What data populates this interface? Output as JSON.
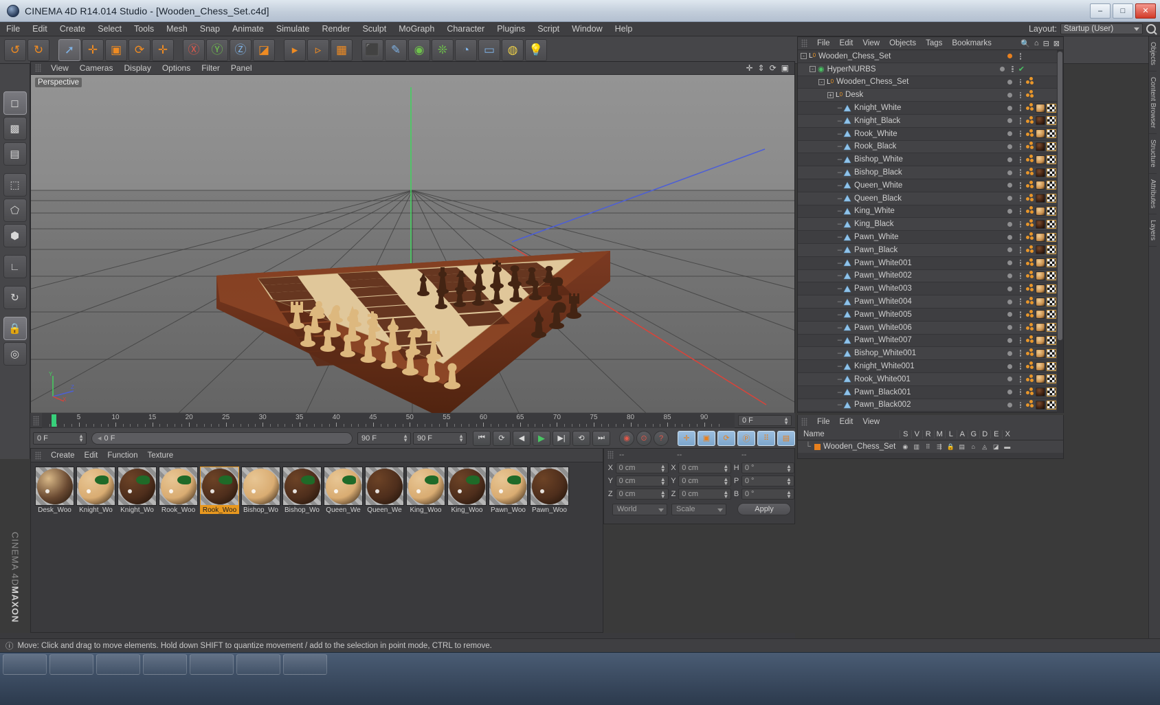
{
  "window": {
    "title": "CINEMA 4D R14.014 Studio - [Wooden_Chess_Set.c4d]",
    "minimize": "–",
    "maximize": "□",
    "close": "✕"
  },
  "menubar": {
    "items": [
      "File",
      "Edit",
      "Create",
      "Select",
      "Tools",
      "Mesh",
      "Snap",
      "Animate",
      "Simulate",
      "Render",
      "Sculpt",
      "MoGraph",
      "Character",
      "Plugins",
      "Script",
      "Window",
      "Help"
    ],
    "layout_label": "Layout:",
    "layout_value": "Startup (User)"
  },
  "toolbar": {
    "buttons": [
      {
        "name": "undo-button",
        "glyph": "↺",
        "color": "or"
      },
      {
        "name": "redo-button",
        "glyph": "↻",
        "color": "or"
      },
      {
        "name": "select-tool-button",
        "glyph": "➚",
        "color": "bl"
      },
      {
        "name": "move-tool-button",
        "glyph": "✛",
        "color": "or"
      },
      {
        "name": "scale-tool-button",
        "glyph": "▣",
        "color": "or"
      },
      {
        "name": "rotate-tool-button",
        "glyph": "⟳",
        "color": "or"
      },
      {
        "name": "move-axis-button",
        "glyph": "✛",
        "color": "or"
      },
      {
        "name": "lock-x-axis-button",
        "glyph": "Ⓧ",
        "color": "rd"
      },
      {
        "name": "lock-y-axis-button",
        "glyph": "Ⓨ",
        "color": "gr"
      },
      {
        "name": "lock-z-axis-button",
        "glyph": "Ⓩ",
        "color": "bl"
      },
      {
        "name": "world-object-coord-button",
        "glyph": "◪",
        "color": "or"
      },
      {
        "name": "render-view-button",
        "glyph": "▸",
        "color": "or"
      },
      {
        "name": "render-region-button",
        "glyph": "▹",
        "color": "or"
      },
      {
        "name": "render-settings-button",
        "glyph": "▦",
        "color": "or"
      },
      {
        "name": "cube-primitive-button",
        "glyph": "⬛",
        "color": "bl"
      },
      {
        "name": "spline-button",
        "glyph": "✎",
        "color": "bl"
      },
      {
        "name": "nurbs-button",
        "glyph": "◉",
        "color": "gr"
      },
      {
        "name": "array-button",
        "glyph": "❊",
        "color": "gr"
      },
      {
        "name": "deformer-button",
        "glyph": "◔",
        "color": "bl"
      },
      {
        "name": "camera-button",
        "glyph": "▭",
        "color": "bl"
      },
      {
        "name": "scene-button",
        "glyph": "◍",
        "color": "ye"
      },
      {
        "name": "light-button",
        "glyph": "💡",
        "color": "ye"
      }
    ]
  },
  "left_palette": [
    {
      "name": "model-mode-button",
      "glyph": "◻"
    },
    {
      "name": "texture-mode-button",
      "glyph": "▩"
    },
    {
      "name": "layer-mode-button",
      "glyph": "▤"
    },
    {
      "name": "points-mode-button",
      "glyph": "⬚"
    },
    {
      "name": "edges-mode-button",
      "glyph": "⬠"
    },
    {
      "name": "polygons-mode-button",
      "glyph": "⬢"
    },
    {
      "name": "axis-mode-button",
      "glyph": "∟"
    },
    {
      "name": "workplane-button",
      "glyph": "↻"
    },
    {
      "name": "lock-workplane-button",
      "glyph": "🔒"
    },
    {
      "name": "enable-snap-button",
      "glyph": "◎"
    }
  ],
  "viewport": {
    "menu": [
      "View",
      "Cameras",
      "Display",
      "Options",
      "Filter",
      "Panel"
    ],
    "right_icons": [
      "move-view-icon",
      "dolly-view-icon",
      "rotate-view-icon",
      "maximize-view-icon"
    ],
    "label": "Perspective"
  },
  "timeline": {
    "ticks": [
      5,
      10,
      15,
      20,
      25,
      30,
      35,
      40,
      45,
      50,
      55,
      60,
      65,
      70,
      75,
      80,
      85,
      90
    ],
    "end_frame": "0 F"
  },
  "playbar": {
    "current_frame": "0 F",
    "slider_value": "0 F",
    "range_end": "90 F",
    "range_end2": "90 F",
    "buttons": [
      {
        "name": "goto-start-button",
        "glyph": "⏮"
      },
      {
        "name": "loop-button",
        "glyph": "⟳"
      },
      {
        "name": "step-back-button",
        "glyph": "◀"
      },
      {
        "name": "play-button",
        "glyph": "▶"
      },
      {
        "name": "step-forward-button",
        "glyph": "▶|"
      },
      {
        "name": "play-reverse-button",
        "glyph": "⟲"
      },
      {
        "name": "goto-end-button",
        "glyph": "⏭"
      },
      {
        "name": "autokey-button",
        "glyph": "◉"
      },
      {
        "name": "record-button",
        "glyph": "⊙"
      },
      {
        "name": "keyframe-help-button",
        "glyph": "?"
      },
      {
        "name": "position-key-button",
        "glyph": "✛"
      },
      {
        "name": "scale-key-button",
        "glyph": "▣"
      },
      {
        "name": "rotation-key-button",
        "glyph": "⟳"
      },
      {
        "name": "param-key-button",
        "glyph": "Ⓟ"
      },
      {
        "name": "pointlevel-key-button",
        "glyph": "⠿"
      },
      {
        "name": "keyframe-select-button",
        "glyph": "▤"
      }
    ]
  },
  "material_manager": {
    "menu": [
      "Create",
      "Edit",
      "Function",
      "Texture"
    ],
    "materials": [
      {
        "name": "Desk_Woo",
        "base": "#6a4a32",
        "sec": "#d9b887",
        "green": false,
        "selected": false
      },
      {
        "name": "Knight_Wo",
        "base": "#d9ac72",
        "sec": "#e8c694",
        "green": true,
        "selected": false
      },
      {
        "name": "Knight_Wo",
        "base": "#4e2e1c",
        "sec": "#6d4326",
        "green": true,
        "selected": false
      },
      {
        "name": "Rook_Woo",
        "base": "#d9ac72",
        "sec": "#e8c694",
        "green": true,
        "selected": false
      },
      {
        "name": "Rook_Woo",
        "base": "#4e2e1c",
        "sec": "#6d4326",
        "green": true,
        "selected": true
      },
      {
        "name": "Bishop_Wo",
        "base": "#d9ac72",
        "sec": "#e8c694",
        "green": false,
        "selected": false
      },
      {
        "name": "Bishop_Wo",
        "base": "#4e2e1c",
        "sec": "#6d4326",
        "green": true,
        "selected": false
      },
      {
        "name": "Queen_We",
        "base": "#d9ac72",
        "sec": "#e8c694",
        "green": true,
        "selected": false
      },
      {
        "name": "Queen_We",
        "base": "#4e2e1c",
        "sec": "#6d4326",
        "green": false,
        "selected": false
      },
      {
        "name": "King_Woo",
        "base": "#d9ac72",
        "sec": "#e8c694",
        "green": true,
        "selected": false
      },
      {
        "name": "King_Woo",
        "base": "#4e2e1c",
        "sec": "#6d4326",
        "green": true,
        "selected": false
      },
      {
        "name": "Pawn_Woo",
        "base": "#d9ac72",
        "sec": "#e8c694",
        "green": true,
        "selected": false
      },
      {
        "name": "Pawn_Woo",
        "base": "#4e2e1c",
        "sec": "#6d4326",
        "green": false,
        "selected": false
      }
    ]
  },
  "coordinates": {
    "header_left": "--",
    "header_mid": "--",
    "header_right": "--",
    "rows": [
      {
        "l1": "X",
        "v1": "0 cm",
        "l2": "X",
        "v2": "0 cm",
        "l3": "H",
        "v3": "0 °"
      },
      {
        "l1": "Y",
        "v1": "0 cm",
        "l2": "Y",
        "v2": "0 cm",
        "l3": "P",
        "v3": "0 °"
      },
      {
        "l1": "Z",
        "v1": "0 cm",
        "l2": "Z",
        "v2": "0 cm",
        "l3": "B",
        "v3": "0 °"
      }
    ],
    "world_value": "World",
    "scale_value": "Scale",
    "apply_label": "Apply"
  },
  "object_manager": {
    "menu": [
      "File",
      "Edit",
      "View",
      "Objects",
      "Tags",
      "Bookmarks"
    ],
    "right_icons": [
      "search-icon",
      "home-icon",
      "minimize-icon",
      "close-icon"
    ],
    "objects": [
      {
        "label": "Wooden_Chess_Set",
        "indent": 0,
        "expander": "-",
        "icon": "null",
        "dot": "or",
        "check": false,
        "tags": []
      },
      {
        "label": "HyperNURBS",
        "indent": 1,
        "expander": "-",
        "icon": "hypernurbs",
        "dot": "gray",
        "check": true,
        "tags": []
      },
      {
        "label": "Wooden_Chess_Set",
        "indent": 2,
        "expander": "-",
        "icon": "null",
        "dot": "gray",
        "check": false,
        "tags": [
          "dots"
        ]
      },
      {
        "label": "Desk",
        "indent": 3,
        "expander": "+",
        "icon": "null",
        "dot": "gray",
        "check": false,
        "tags": [
          "dots"
        ]
      },
      {
        "label": "Knight_White",
        "indent": 4,
        "expander": "",
        "icon": "poly",
        "dot": "gray",
        "check": false,
        "tags": [
          "dots",
          "mat-light",
          "checker"
        ]
      },
      {
        "label": "Knight_Black",
        "indent": 4,
        "expander": "",
        "icon": "poly",
        "dot": "gray",
        "check": false,
        "tags": [
          "dots",
          "mat-dark",
          "checker"
        ]
      },
      {
        "label": "Rook_White",
        "indent": 4,
        "expander": "",
        "icon": "poly",
        "dot": "gray",
        "check": false,
        "tags": [
          "dots",
          "mat-light",
          "checker"
        ]
      },
      {
        "label": "Rook_Black",
        "indent": 4,
        "expander": "",
        "icon": "poly",
        "dot": "gray",
        "check": false,
        "tags": [
          "dots",
          "mat-dark",
          "checker"
        ]
      },
      {
        "label": "Bishop_White",
        "indent": 4,
        "expander": "",
        "icon": "poly",
        "dot": "gray",
        "check": false,
        "tags": [
          "dots",
          "mat-light",
          "checker"
        ]
      },
      {
        "label": "Bishop_Black",
        "indent": 4,
        "expander": "",
        "icon": "poly",
        "dot": "gray",
        "check": false,
        "tags": [
          "dots",
          "mat-dark",
          "checker"
        ]
      },
      {
        "label": "Queen_White",
        "indent": 4,
        "expander": "",
        "icon": "poly",
        "dot": "gray",
        "check": false,
        "tags": [
          "dots",
          "mat-light",
          "checker"
        ]
      },
      {
        "label": "Queen_Black",
        "indent": 4,
        "expander": "",
        "icon": "poly",
        "dot": "gray",
        "check": false,
        "tags": [
          "dots",
          "mat-dark",
          "checker"
        ]
      },
      {
        "label": "King_White",
        "indent": 4,
        "expander": "",
        "icon": "poly",
        "dot": "gray",
        "check": false,
        "tags": [
          "dots",
          "mat-light",
          "checker"
        ]
      },
      {
        "label": "King_Black",
        "indent": 4,
        "expander": "",
        "icon": "poly",
        "dot": "gray",
        "check": false,
        "tags": [
          "dots",
          "mat-dark",
          "checker"
        ]
      },
      {
        "label": "Pawn_White",
        "indent": 4,
        "expander": "",
        "icon": "poly",
        "dot": "gray",
        "check": false,
        "tags": [
          "dots",
          "mat-light",
          "checker"
        ]
      },
      {
        "label": "Pawn_Black",
        "indent": 4,
        "expander": "",
        "icon": "poly",
        "dot": "gray",
        "check": false,
        "tags": [
          "dots",
          "mat-dark",
          "checker"
        ]
      },
      {
        "label": "Pawn_White001",
        "indent": 4,
        "expander": "",
        "icon": "poly",
        "dot": "gray",
        "check": false,
        "tags": [
          "dots",
          "mat-light",
          "checker"
        ]
      },
      {
        "label": "Pawn_White002",
        "indent": 4,
        "expander": "",
        "icon": "poly",
        "dot": "gray",
        "check": false,
        "tags": [
          "dots",
          "mat-light",
          "checker"
        ]
      },
      {
        "label": "Pawn_White003",
        "indent": 4,
        "expander": "",
        "icon": "poly",
        "dot": "gray",
        "check": false,
        "tags": [
          "dots",
          "mat-light",
          "checker"
        ]
      },
      {
        "label": "Pawn_White004",
        "indent": 4,
        "expander": "",
        "icon": "poly",
        "dot": "gray",
        "check": false,
        "tags": [
          "dots",
          "mat-light",
          "checker"
        ]
      },
      {
        "label": "Pawn_White005",
        "indent": 4,
        "expander": "",
        "icon": "poly",
        "dot": "gray",
        "check": false,
        "tags": [
          "dots",
          "mat-light",
          "checker"
        ]
      },
      {
        "label": "Pawn_White006",
        "indent": 4,
        "expander": "",
        "icon": "poly",
        "dot": "gray",
        "check": false,
        "tags": [
          "dots",
          "mat-light",
          "checker"
        ]
      },
      {
        "label": "Pawn_White007",
        "indent": 4,
        "expander": "",
        "icon": "poly",
        "dot": "gray",
        "check": false,
        "tags": [
          "dots",
          "mat-light",
          "checker"
        ]
      },
      {
        "label": "Bishop_White001",
        "indent": 4,
        "expander": "",
        "icon": "poly",
        "dot": "gray",
        "check": false,
        "tags": [
          "dots",
          "mat-light",
          "checker"
        ]
      },
      {
        "label": "Knight_White001",
        "indent": 4,
        "expander": "",
        "icon": "poly",
        "dot": "gray",
        "check": false,
        "tags": [
          "dots",
          "mat-light",
          "checker"
        ]
      },
      {
        "label": "Rook_White001",
        "indent": 4,
        "expander": "",
        "icon": "poly",
        "dot": "gray",
        "check": false,
        "tags": [
          "dots",
          "mat-light",
          "checker"
        ]
      },
      {
        "label": "Pawn_Black001",
        "indent": 4,
        "expander": "",
        "icon": "poly",
        "dot": "gray",
        "check": false,
        "tags": [
          "dots",
          "mat-dark",
          "checker"
        ]
      },
      {
        "label": "Pawn_Black002",
        "indent": 4,
        "expander": "",
        "icon": "poly",
        "dot": "gray",
        "check": false,
        "tags": [
          "dots",
          "mat-dark",
          "checker"
        ]
      }
    ]
  },
  "attribute_manager": {
    "menu": [
      "File",
      "Edit",
      "View"
    ]
  },
  "layer_manager": {
    "name_header": "Name",
    "columns": [
      "S",
      "V",
      "R",
      "M",
      "L",
      "A",
      "G",
      "D",
      "E",
      "X"
    ],
    "row_name": "Wooden_Chess_Set",
    "row_icons": [
      "◉",
      "▥",
      "⠿",
      "⇶",
      "🔒",
      "▤",
      "⌂",
      "◬",
      "◪",
      "▬"
    ]
  },
  "right_tabs": [
    "Objects",
    "Content Browser",
    "Structure",
    "Attributes",
    "Layers"
  ],
  "statusbar": {
    "text": "Move: Click and drag to move elements. Hold down SHIFT to quantize movement / add to the selection in point mode, CTRL to remove."
  },
  "branding": {
    "maxon": "MAXON",
    "product": "CINEMA 4D"
  }
}
